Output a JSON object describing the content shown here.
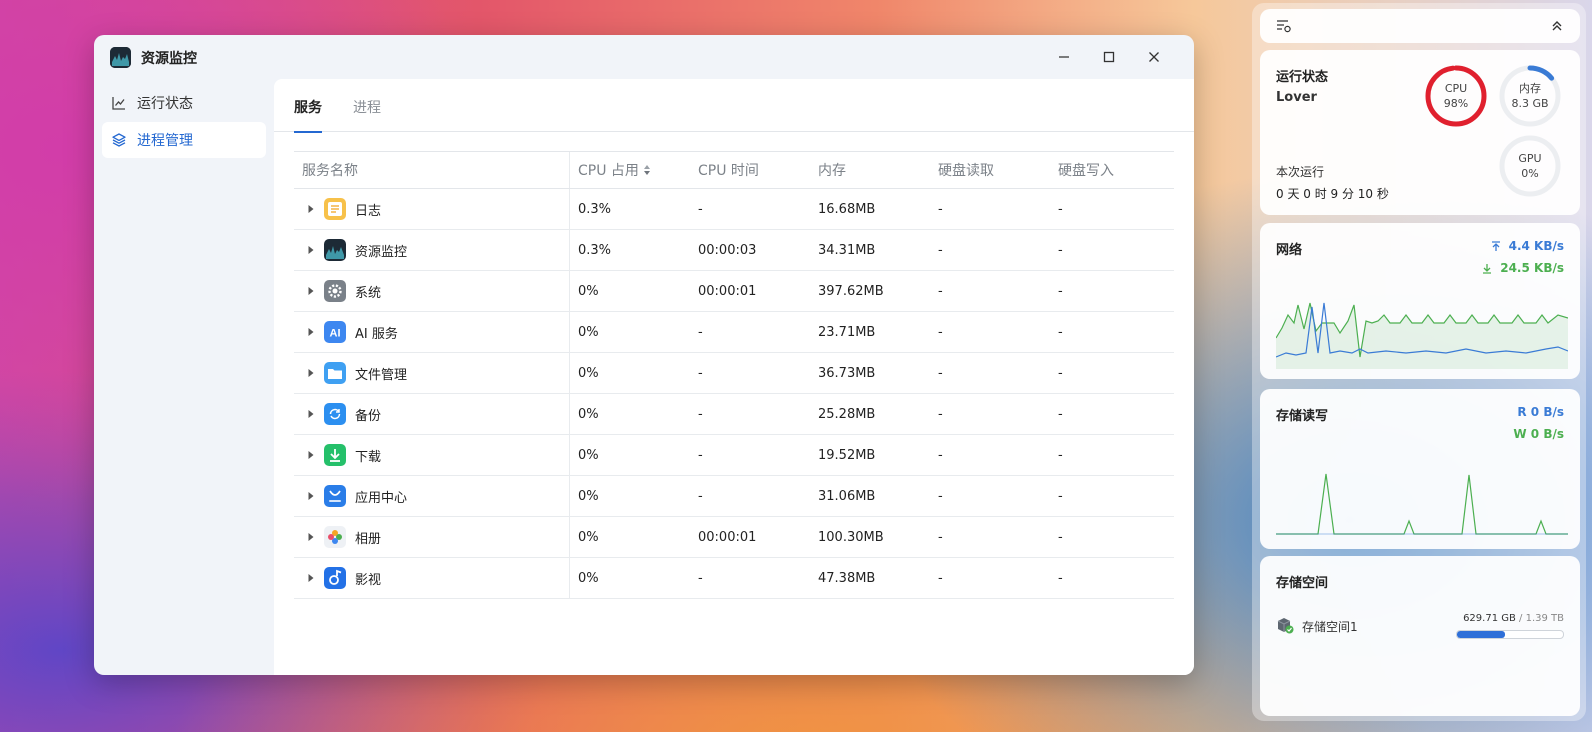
{
  "window": {
    "title": "资源监控"
  },
  "sidebar": {
    "items": [
      {
        "label": "运行状态",
        "icon": "line-chart-icon"
      },
      {
        "label": "进程管理",
        "icon": "layers-icon",
        "active": true
      }
    ]
  },
  "tabs": [
    {
      "label": "服务",
      "active": true
    },
    {
      "label": "进程",
      "active": false
    }
  ],
  "table": {
    "columns": [
      "服务名称",
      "CPU 占用",
      "CPU 时间",
      "内存",
      "硬盘读取",
      "硬盘写入"
    ],
    "rows": [
      {
        "name": "日志",
        "icon": "log-icon",
        "cpu": "0.3%",
        "cpu_time": "-",
        "memory": "16.68MB",
        "disk_read": "-",
        "disk_write": "-"
      },
      {
        "name": "资源监控",
        "icon": "monitor-icon",
        "cpu": "0.3%",
        "cpu_time": "00:00:03",
        "memory": "34.31MB",
        "disk_read": "-",
        "disk_write": "-"
      },
      {
        "name": "系统",
        "icon": "system-gear-icon",
        "cpu": "0%",
        "cpu_time": "00:00:01",
        "memory": "397.62MB",
        "disk_read": "-",
        "disk_write": "-"
      },
      {
        "name": "AI 服务",
        "icon": "ai-icon",
        "cpu": "0%",
        "cpu_time": "-",
        "memory": "23.71MB",
        "disk_read": "-",
        "disk_write": "-"
      },
      {
        "name": "文件管理",
        "icon": "folder-icon",
        "cpu": "0%",
        "cpu_time": "-",
        "memory": "36.73MB",
        "disk_read": "-",
        "disk_write": "-"
      },
      {
        "name": "备份",
        "icon": "backup-icon",
        "cpu": "0%",
        "cpu_time": "-",
        "memory": "25.28MB",
        "disk_read": "-",
        "disk_write": "-"
      },
      {
        "name": "下载",
        "icon": "download-icon",
        "cpu": "0%",
        "cpu_time": "-",
        "memory": "19.52MB",
        "disk_read": "-",
        "disk_write": "-"
      },
      {
        "name": "应用中心",
        "icon": "store-icon",
        "cpu": "0%",
        "cpu_time": "-",
        "memory": "31.06MB",
        "disk_read": "-",
        "disk_write": "-"
      },
      {
        "name": "相册",
        "icon": "photos-icon",
        "cpu": "0%",
        "cpu_time": "00:00:01",
        "memory": "100.30MB",
        "disk_read": "-",
        "disk_write": "-"
      },
      {
        "name": "影视",
        "icon": "video-icon",
        "cpu": "0%",
        "cpu_time": "-",
        "memory": "47.38MB",
        "disk_read": "-",
        "disk_write": "-"
      }
    ]
  },
  "widgets": {
    "status": {
      "title": "运行状态",
      "device": "Lover",
      "uptime_label": "本次运行",
      "uptime": "0 天 0 时 9 分 10 秒",
      "cpu_label": "CPU",
      "cpu_value": "98%",
      "cpu_fraction": 0.98,
      "mem_label": "内存",
      "mem_value": "8.3 GB",
      "mem_fraction": 0.14,
      "gpu_label": "GPU",
      "gpu_value": "0%",
      "gpu_fraction": 0
    },
    "network": {
      "title": "网络",
      "upload": "4.4 KB/s",
      "download": "24.5 KB/s"
    },
    "storage_io": {
      "title": "存储读写",
      "read": "R  0 B/s",
      "write": "W  0 B/s"
    },
    "storage_space": {
      "title": "存储空间",
      "volume_name": "存储空间1",
      "used": "629.71 GB",
      "total": "/ 1.39 TB",
      "used_fraction": 0.45
    }
  },
  "colors": {
    "accent": "#2468d1",
    "cpu_ring": "#e0202e",
    "upload": "#3a7bd5",
    "download": "#4caf50"
  }
}
